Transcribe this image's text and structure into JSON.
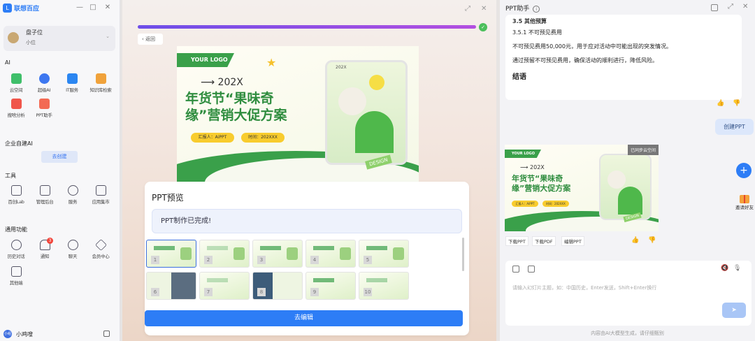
{
  "sidebar": {
    "brand": "联想百应",
    "window_controls": [
      "—",
      "□",
      "✕"
    ],
    "user": {
      "name": "盘子位",
      "sub": "小位"
    },
    "sections": {
      "ai": "AI",
      "enterprise": "企业自建AI",
      "tools": "工具",
      "common": "通用功能"
    },
    "ai_items": [
      {
        "label": "云空间",
        "color": "#3fbf6a"
      },
      {
        "label": "超级AI",
        "color": "#3d77f0"
      },
      {
        "label": "IT服务",
        "color": "#2b86f1"
      },
      {
        "label": "知识库检索",
        "color": "#f0a23b"
      },
      {
        "label": "搜啥分析",
        "color": "#f0554a"
      },
      {
        "label": "PPT助手",
        "color": "#f36a54"
      }
    ],
    "create_label": "去创建",
    "tool_items": [
      {
        "label": "百创Lab"
      },
      {
        "label": "管理后台"
      },
      {
        "label": "服务"
      },
      {
        "label": "应用集市"
      }
    ],
    "common_items": [
      {
        "label": "历史对话"
      },
      {
        "label": "通知",
        "badge": "3"
      },
      {
        "label": "聊天"
      },
      {
        "label": "会员中心"
      },
      {
        "label": "其他端"
      }
    ],
    "bottom_user": {
      "avatar": "小组",
      "name": "小鸡嗖"
    }
  },
  "middle": {
    "back_label": "返回",
    "slide": {
      "logo": "YOUR LOGO",
      "year": "202X",
      "title_line1": "年货节“果味奇",
      "title_line2": "缘”营销大促方案",
      "reporter": "汇报人：AiPPT",
      "date": "时间：202XXX",
      "phone_year": "202X",
      "design": "DESIGN"
    },
    "panel_title": "PPT预览",
    "done_text": "PPT制作已完成!",
    "thumbnails": [
      {
        "num": "1"
      },
      {
        "num": "2"
      },
      {
        "num": "3"
      },
      {
        "num": "4"
      },
      {
        "num": "5"
      },
      {
        "num": "6"
      },
      {
        "num": "7"
      },
      {
        "num": "8"
      },
      {
        "num": "9"
      },
      {
        "num": "10"
      }
    ],
    "edit_label": "去编辑"
  },
  "right": {
    "title": "PPT助手",
    "info_icon": "i",
    "content": {
      "line0": "3.5 其他预算",
      "line1": "3.5.1 不可预见费用",
      "line2": "不可预见费用50,000元，用于应对活动中可能出现的突发情况。",
      "line3": "通过预留不可预见费用，确保活动的顺利进行，降低风险。",
      "line4": "结语"
    },
    "create_ppt": "创建PPT",
    "synced": "已同步云空间",
    "actions": [
      "下载PPT",
      "下载PDF",
      "编辑PPT"
    ],
    "input_placeholder": "请输入幻灯片主题，如：中国历史，Enter发送，Shift+Enter换行",
    "footer": "内容由AI大模型生成，请仔细甄别",
    "invite": "邀请好友"
  }
}
